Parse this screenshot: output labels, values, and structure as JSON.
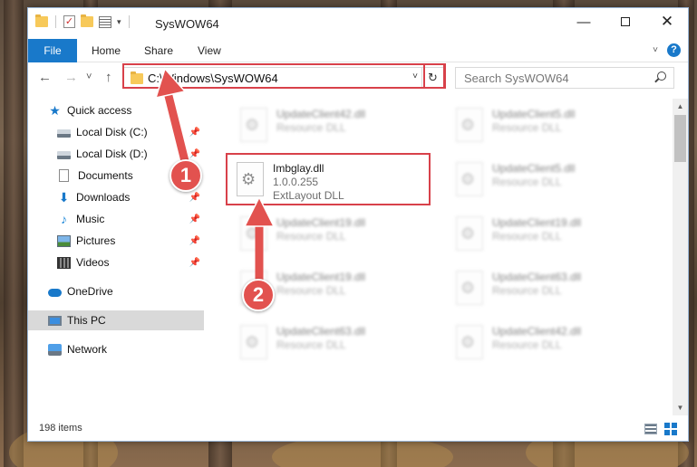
{
  "window": {
    "title": "SysWOW64",
    "minimize_glyph": "—",
    "close_glyph": "✕"
  },
  "ribbon": {
    "tabs": [
      "File",
      "Home",
      "Share",
      "View"
    ],
    "help_glyph": "?"
  },
  "navbar": {
    "back_glyph": "←",
    "forward_glyph": "→",
    "recent_glyph": "˅",
    "up_glyph": "↑",
    "address": "C:\\Windows\\SysWOW64",
    "search_placeholder": "Search SysWOW64"
  },
  "sidebar": {
    "items": [
      {
        "label": "Quick access",
        "icon": "star-icon",
        "pinned": false
      },
      {
        "label": "Local Disk (C:)",
        "icon": "drive-icon",
        "pinned": true
      },
      {
        "label": "Local Disk (D:)",
        "icon": "drive-icon",
        "pinned": true
      },
      {
        "label": "Documents",
        "icon": "documents-icon",
        "pinned": true
      },
      {
        "label": "Downloads",
        "icon": "downloads-icon",
        "pinned": true
      },
      {
        "label": "Music",
        "icon": "music-icon",
        "pinned": true
      },
      {
        "label": "Pictures",
        "icon": "pictures-icon",
        "pinned": true
      },
      {
        "label": "Videos",
        "icon": "videos-icon",
        "pinned": true
      },
      {
        "label": "OneDrive",
        "icon": "onedrive-icon",
        "pinned": false
      },
      {
        "label": "This PC",
        "icon": "this-pc-icon",
        "pinned": false,
        "selected": true
      },
      {
        "label": "Network",
        "icon": "network-icon",
        "pinned": false
      }
    ]
  },
  "files": {
    "highlighted": {
      "name": "Imbglay.dll",
      "version": "1.0.0.255",
      "description": "ExtLayout DLL"
    },
    "left_column": [
      {
        "name": "UpdateClient42.dll",
        "description": "Resource DLL"
      },
      {
        "name": "UpdateClient19.dll",
        "description": "Resource DLL"
      },
      {
        "name": "UpdateClient19.dll",
        "description": "Resource DLL"
      },
      {
        "name": "UpdateClient63.dll",
        "description": "Resource DLL"
      }
    ],
    "right_column": [
      {
        "name": "UpdateClient5.dll",
        "description": "Resource DLL"
      },
      {
        "name": "UpdateClient5.dll",
        "description": "Resource DLL"
      },
      {
        "name": "UpdateClient19.dll",
        "description": "Resource DLL"
      },
      {
        "name": "UpdateClient63.dll",
        "description": "Resource DLL"
      },
      {
        "name": "UpdateClient42.dll",
        "description": "Resource DLL"
      }
    ]
  },
  "status": {
    "item_count": "198 items"
  },
  "annotations": {
    "step1": "1",
    "step2": "2",
    "color": "#e2524f"
  },
  "colors": {
    "accent": "#1979ca",
    "highlight_border": "#d8414a"
  }
}
